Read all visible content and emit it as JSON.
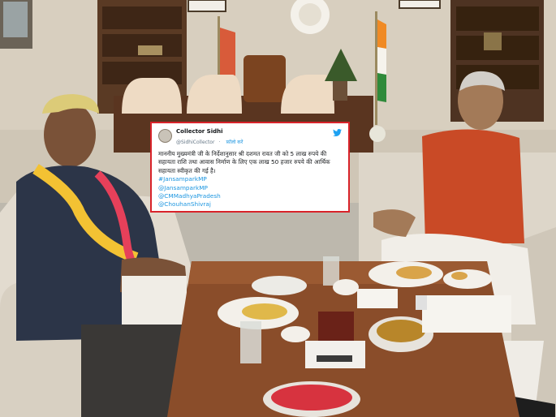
{
  "tweet": {
    "account_name": "Collector Sidhi",
    "handle": "@SidhiCollector",
    "follow_label": "फ़ॉलो करें",
    "text": "माननीय मुख्यमंत्री जी के निर्देशानुसार श्री दशमत रावत जी को  5 लाख रुपये की सहायता राशि तथा आवास निर्माण के लिए एक लाख 50 हजार रुपये की आर्थिक सहायता स्वीकृत की गई है।",
    "links": [
      "#JansamparkMP",
      "@JansamparkMP",
      "@CMMadhyaPradesh",
      "@ChouhanShivraj"
    ]
  },
  "colors": {
    "border": "#d9232a",
    "link": "#1b95e0",
    "twitter": "#1da1f2"
  },
  "icons": {
    "platform": "twitter-bird-icon",
    "profile": "avatar"
  }
}
